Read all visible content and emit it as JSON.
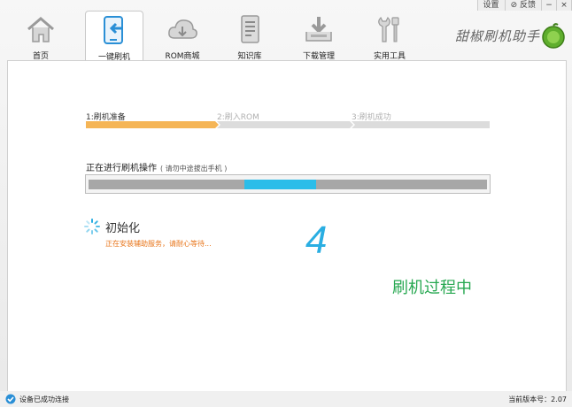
{
  "topbar": {
    "settings": "设置",
    "feedback": "反馈",
    "minimize": "−",
    "close": "×"
  },
  "nav": [
    {
      "label": "首页",
      "icon": "home-icon"
    },
    {
      "label": "一键刷机",
      "icon": "phone-flash-icon"
    },
    {
      "label": "ROM商城",
      "icon": "cloud-download-icon"
    },
    {
      "label": "知识库",
      "icon": "document-icon"
    },
    {
      "label": "下载管理",
      "icon": "download-tray-icon"
    },
    {
      "label": "实用工具",
      "icon": "tools-icon"
    }
  ],
  "active_tab": "一键刷机",
  "brand": {
    "name": "甜椒刷机助手"
  },
  "steps": [
    {
      "label": "1:刷机准备",
      "state": "done"
    },
    {
      "label": "2:刷入ROM",
      "state": "todo"
    },
    {
      "label": "3:刷机成功",
      "state": "todo"
    }
  ],
  "operation": {
    "title": "正在进行刷机操作",
    "note": "( 请勿中途拔出手机 )"
  },
  "progress": {
    "segment_start": 0.39,
    "segment_end": 0.57
  },
  "status": {
    "title": "初始化",
    "detail": "正在安装辅助服务，请耐心等待..."
  },
  "step_number": "4",
  "caption": "刷机过程中",
  "statusbar": {
    "connection": "设备已成功连接",
    "version": "当前版本号：2.07"
  },
  "colors": {
    "accent_orange": "#f5b556",
    "progress_blue": "#2bbde9",
    "caption_green": "#27a851",
    "detail_orange": "#e8751a"
  }
}
